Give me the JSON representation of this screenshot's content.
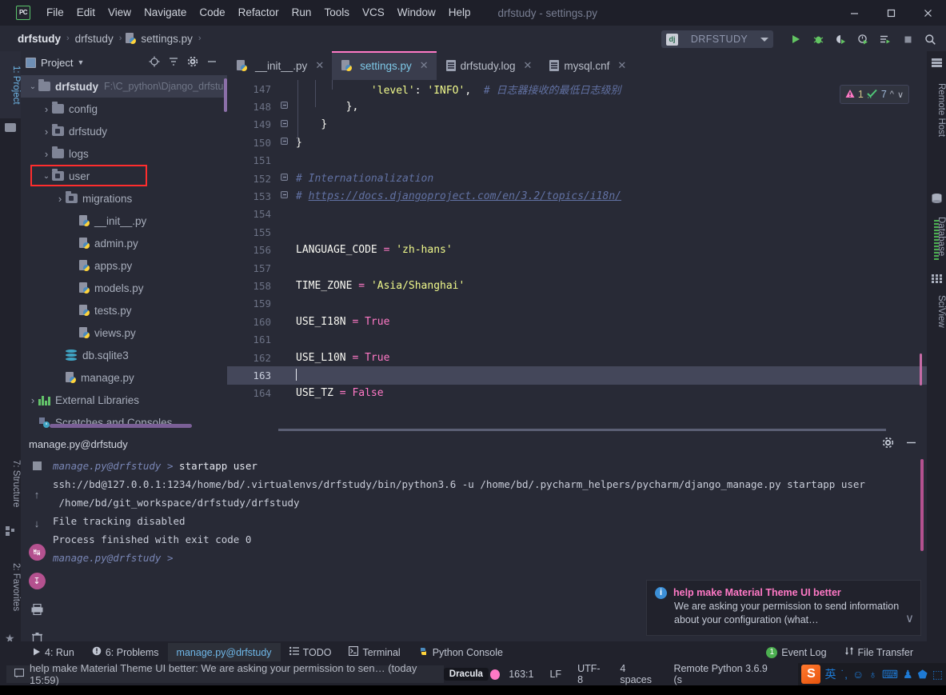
{
  "window": {
    "title": "drfstudy - settings.py",
    "app_icon": "pycharm-logo",
    "minimize": "─",
    "maximize": "☐",
    "close": "✕"
  },
  "menu": [
    {
      "label": "File"
    },
    {
      "label": "Edit"
    },
    {
      "label": "View"
    },
    {
      "label": "Navigate"
    },
    {
      "label": "Code"
    },
    {
      "label": "Refactor"
    },
    {
      "label": "Run"
    },
    {
      "label": "Tools"
    },
    {
      "label": "VCS"
    },
    {
      "label": "Window"
    },
    {
      "label": "Help"
    }
  ],
  "breadcrumb": {
    "items": [
      "drfstudy",
      "drfstudy",
      "settings.py"
    ],
    "separator": "›"
  },
  "run_config": {
    "icon": "django-icon",
    "icon_text": "dj",
    "label": "DRFSTUDY",
    "dropdown": "▾"
  },
  "toolbar_icons": [
    {
      "name": "run-icon",
      "glyph": "▶",
      "color": "#62c462"
    },
    {
      "name": "debug-icon",
      "glyph": "⚙",
      "color": "#62c462"
    },
    {
      "name": "run-coverage-icon",
      "glyph": "◐",
      "color": "#62c462"
    },
    {
      "name": "profile-icon",
      "glyph": "◴",
      "color": "#62c462"
    },
    {
      "name": "run-with-console-icon",
      "glyph": "☰",
      "color": "#62c462"
    },
    {
      "name": "stop-icon",
      "glyph": "■",
      "color": "#8b909e"
    },
    {
      "name": "search-everywhere-icon",
      "glyph": "⌕",
      "color": "#c3c8d4"
    }
  ],
  "left_tools": [
    {
      "label": "1: Project",
      "icon": "folder-icon",
      "active": true
    },
    {
      "label": "7: Structure",
      "icon": "structure-icon",
      "active": false
    },
    {
      "label": "2: Favorites",
      "icon": "star-icon",
      "active": false
    }
  ],
  "right_tools": [
    {
      "label": "Remote Host",
      "icon": "remote-host-icon"
    },
    {
      "label": "Database",
      "icon": "database-icon"
    },
    {
      "label": "SciView",
      "icon": "sciview-icon"
    }
  ],
  "project_panel": {
    "title": "Project",
    "dropdown": "▾",
    "header_icons": [
      {
        "name": "locate-icon",
        "glyph": "⊕"
      },
      {
        "name": "collapse-all-icon",
        "glyph": "≣"
      },
      {
        "name": "settings-gear-icon",
        "glyph": "⚙"
      },
      {
        "name": "hide-panel-icon",
        "glyph": "─"
      }
    ],
    "tree": [
      {
        "label": "drfstudy",
        "path": "F:\\C_python\\Django_drfstudy",
        "depth": 0,
        "type": "folder",
        "arrow": "⌄",
        "root": true,
        "selected": true
      },
      {
        "label": "config",
        "depth": 1,
        "type": "folder",
        "arrow": "›"
      },
      {
        "label": "drfstudy",
        "depth": 1,
        "type": "folder-module",
        "arrow": "›"
      },
      {
        "label": "logs",
        "depth": 1,
        "type": "folder",
        "arrow": "›"
      },
      {
        "label": "user",
        "depth": 1,
        "type": "folder-module",
        "arrow": "⌄",
        "highlight": true
      },
      {
        "label": "migrations",
        "depth": 2,
        "type": "folder-module",
        "arrow": "›"
      },
      {
        "label": "__init__.py",
        "depth": 3,
        "type": "python"
      },
      {
        "label": "admin.py",
        "depth": 3,
        "type": "python"
      },
      {
        "label": "apps.py",
        "depth": 3,
        "type": "python"
      },
      {
        "label": "models.py",
        "depth": 3,
        "type": "python"
      },
      {
        "label": "tests.py",
        "depth": 3,
        "type": "python"
      },
      {
        "label": "views.py",
        "depth": 3,
        "type": "python"
      },
      {
        "label": "db.sqlite3",
        "depth": 2,
        "type": "database"
      },
      {
        "label": "manage.py",
        "depth": 2,
        "type": "python"
      },
      {
        "label": "External Libraries",
        "depth": 0,
        "type": "libraries",
        "arrow": "›"
      },
      {
        "label": "Scratches and Consoles",
        "depth": 0,
        "type": "scratches"
      }
    ]
  },
  "editor": {
    "tabs": [
      {
        "label": "__init__.py",
        "icon": "python-file-icon",
        "active": false,
        "close": "✕"
      },
      {
        "label": "settings.py",
        "icon": "python-file-icon",
        "active": true,
        "close": "✕"
      },
      {
        "label": "drfstudy.log",
        "icon": "text-file-icon",
        "active": false,
        "close": "✕"
      },
      {
        "label": "mysql.cnf",
        "icon": "text-file-icon",
        "active": false,
        "close": "✕"
      }
    ],
    "inspections": {
      "warning_icon": "warning-triangle-icon",
      "warning_count": "1",
      "ok_icon": "inspection-ok-icon",
      "ok_count": "7",
      "prev": "⌃",
      "next": "⌄"
    },
    "lines": [
      {
        "num": "147",
        "fold": false,
        "html": "            <span class='k-str'>'level'</span><span class='k-punct'>:</span> <span class='k-str'>'INFO'</span><span class='k-punct'>,</span>  <span class='k-cmt'># 日志器接收的最低日志级别</span>"
      },
      {
        "num": "148",
        "fold": true,
        "html": "        <span class='k-punct'>},</span>"
      },
      {
        "num": "149",
        "fold": true,
        "html": "    <span class='k-punct'>}</span>"
      },
      {
        "num": "150",
        "fold": true,
        "html": "<span class='k-punct'>}</span>"
      },
      {
        "num": "151",
        "fold": false,
        "html": ""
      },
      {
        "num": "152",
        "fold": true,
        "html": "<span class='k-cmt'># Internationalization</span>"
      },
      {
        "num": "153",
        "fold": true,
        "html": "<span class='k-cmt'># </span><span class='k-lnk'>https://docs.djangoproject.com/en/3.2/topics/i18n/</span>"
      },
      {
        "num": "154",
        "fold": false,
        "html": ""
      },
      {
        "num": "155",
        "fold": false,
        "html": ""
      },
      {
        "num": "156",
        "fold": false,
        "html": "<span class='k-var'>LANGUAGE_CODE</span> <span class='k-op'>=</span> <span class='k-str'>'zh-hans'</span>"
      },
      {
        "num": "157",
        "fold": false,
        "html": ""
      },
      {
        "num": "158",
        "fold": false,
        "html": "<span class='k-var'>TIME_ZONE</span> <span class='k-op'>=</span> <span class='k-str'>'Asia/Shanghai'</span>"
      },
      {
        "num": "159",
        "fold": false,
        "html": ""
      },
      {
        "num": "160",
        "fold": false,
        "html": "<span class='k-var'>USE_I18N</span> <span class='k-op'>=</span> <span class='k-kw'>True</span>"
      },
      {
        "num": "161",
        "fold": false,
        "html": ""
      },
      {
        "num": "162",
        "fold": false,
        "html": "<span class='k-var'>USE_L10N</span> <span class='k-op'>=</span> <span class='k-kw'>True</span>"
      },
      {
        "num": "163",
        "fold": false,
        "caret": true,
        "html": "<span class='caret'></span>"
      },
      {
        "num": "164",
        "fold": false,
        "html": "<span class='k-var'>USE_TZ</span> <span class='k-op'>=</span> <span class='k-kw'>False</span>"
      }
    ]
  },
  "run_panel": {
    "title": "manage.py@drfstudy",
    "header_icons": [
      {
        "name": "settings-gear-icon",
        "glyph": "⚙"
      },
      {
        "name": "hide-panel-icon",
        "glyph": "─"
      }
    ],
    "side_icons": [
      {
        "name": "stop-icon",
        "glyph": "■"
      },
      {
        "name": "up-icon",
        "glyph": "↑"
      },
      {
        "name": "down-icon",
        "glyph": "↓"
      },
      {
        "name": "soft-wrap-icon",
        "glyph": "↵"
      },
      {
        "name": "scroll-to-end-icon",
        "glyph": "↡"
      },
      {
        "name": "print-icon",
        "glyph": "⎙"
      },
      {
        "name": "clear-all-icon",
        "glyph": "🗑"
      },
      {
        "name": "close-icon",
        "glyph": "✕"
      }
    ],
    "console": [
      {
        "kind": "prompt",
        "text": "manage.py@drfstudy > ",
        "cmd": "startapp user"
      },
      {
        "kind": "out",
        "text": "ssh://bd@127.0.0.1:1234/home/bd/.virtualenvs/drfstudy/bin/python3.6 -u /home/bd/.pycharm_helpers/pycharm/django_manage.py startapp user"
      },
      {
        "kind": "out",
        "text": " /home/bd/git_workspace/drfstudy/drfstudy"
      },
      {
        "kind": "out",
        "text": "File tracking disabled"
      },
      {
        "kind": "blank",
        "text": ""
      },
      {
        "kind": "out",
        "text": "Process finished with exit code 0"
      },
      {
        "kind": "prompt",
        "text": "manage.py@drfstudy > ",
        "cmd": ""
      }
    ]
  },
  "balloon": {
    "icon": "info-icon",
    "title": "help make Material Theme UI better",
    "body": "We are asking your permission to send information about your configuration (what…",
    "chevron": "⌄"
  },
  "bottom_bar": {
    "left": [
      {
        "label": "4: Run",
        "icon": "run-arrow-icon",
        "selected": false
      },
      {
        "label": "6: Problems",
        "icon": "problems-icon",
        "selected": false
      },
      {
        "label": "manage.py@drfstudy",
        "icon": "",
        "selected": true
      },
      {
        "label": "TODO",
        "icon": "todo-icon",
        "selected": false
      },
      {
        "label": "Terminal",
        "icon": "terminal-icon",
        "selected": false
      },
      {
        "label": "Python Console",
        "icon": "python-console-icon",
        "selected": false
      }
    ],
    "right": [
      {
        "label": "Event Log",
        "icon": "event-log-icon",
        "badge": "1"
      },
      {
        "label": "File Transfer",
        "icon": "file-transfer-icon",
        "badge": ""
      }
    ]
  },
  "status_bar": {
    "message_icon": "balloon-icon",
    "message": "help make Material Theme UI better: We are asking your permission to sen… (today 15:59)",
    "theme": "Dracula",
    "theme_dot_color": "#ff79c6",
    "caret_position": "163:1",
    "line_separator": "LF",
    "encoding": "UTF-8",
    "indent": "4 spaces",
    "interpreter": "Remote Python 3.6.9 (s"
  },
  "ime": {
    "logo": "S",
    "items": [
      {
        "name": "language-mode-icon",
        "glyph": "英"
      },
      {
        "name": "punctuation-icon",
        "glyph": "˙,"
      },
      {
        "name": "emoji-icon",
        "glyph": "☺"
      },
      {
        "name": "voice-input-icon",
        "glyph": "♁"
      },
      {
        "name": "soft-keyboard-icon",
        "glyph": "⌨"
      },
      {
        "name": "user-icon",
        "glyph": "♟"
      },
      {
        "name": "skin-icon",
        "glyph": "⬟"
      },
      {
        "name": "toolbox-icon",
        "glyph": "⬚"
      }
    ]
  }
}
